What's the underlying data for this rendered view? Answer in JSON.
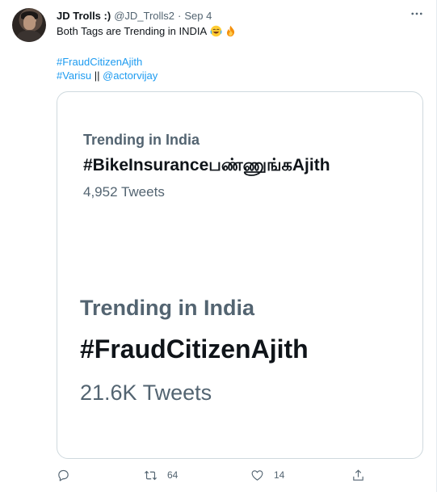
{
  "tweet": {
    "display_name": "JD Trolls :)",
    "handle": "@JD_Trolls2",
    "separator": "·",
    "date": "Sep 4",
    "text": "Both Tags are Trending in INDIA",
    "emojis": [
      "laughing-tears-emoji",
      "fire-emoji"
    ],
    "hashtag_line1": "#FraudCitizenAjith",
    "hashtag_line2_a": "#Varisu",
    "hashtag_line2_sep": " || ",
    "hashtag_line2_b": "@actorvijay"
  },
  "card": {
    "trend1": {
      "title": "Trending in India",
      "tag": "#BikeInsuranceபண்ணுங்கAjith",
      "count": "4,952 Tweets"
    },
    "trend2": {
      "title": "Trending in India",
      "tag": "#FraudCitizenAjith",
      "count": "21.6K Tweets"
    }
  },
  "actions": {
    "reply_count": "",
    "retweet_count": "64",
    "like_count": "14"
  },
  "colors": {
    "link": "#1d9bf0",
    "secondary_text": "#536471",
    "primary_text": "#0f1419",
    "border": "#cfd9de"
  }
}
